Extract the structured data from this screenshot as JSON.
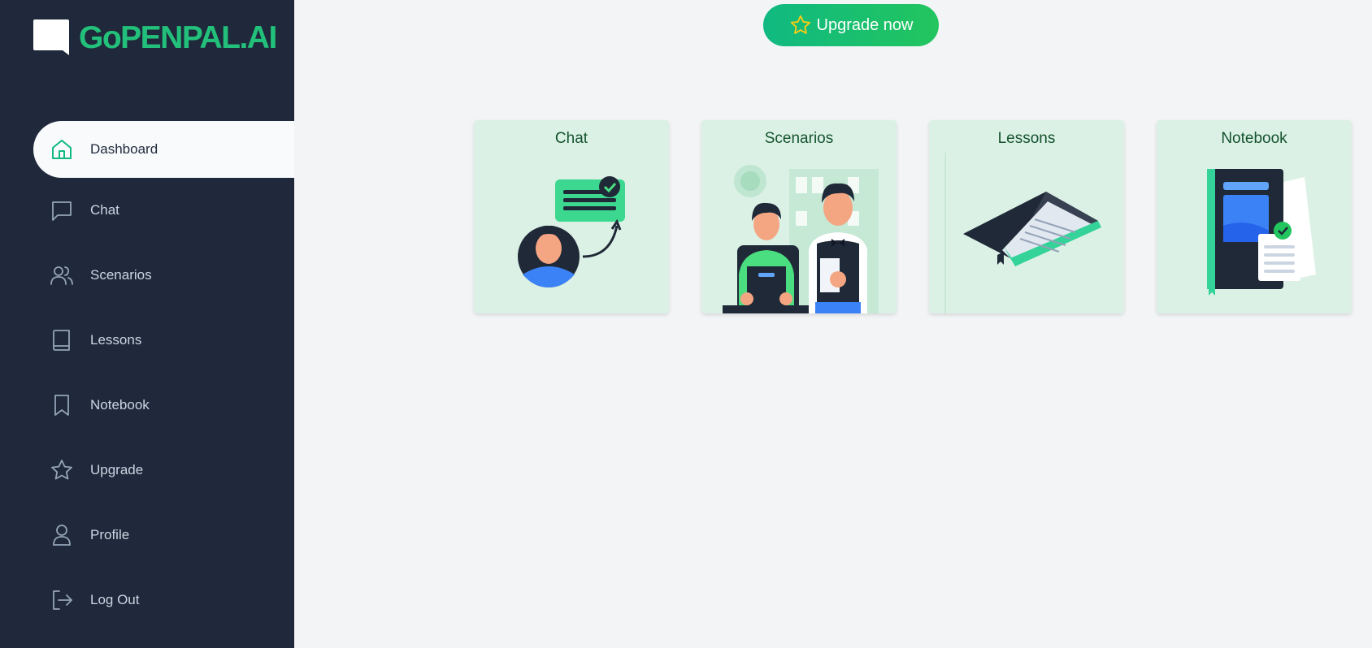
{
  "brand": {
    "name": "GoPENPAL.AI",
    "color": "#22c07a"
  },
  "sidebar": {
    "items": [
      {
        "label": "Dashboard",
        "icon": "home-icon",
        "active": true
      },
      {
        "label": "Chat",
        "icon": "chat-bubble-icon"
      },
      {
        "label": "Scenarios",
        "icon": "users-icon"
      },
      {
        "label": "Lessons",
        "icon": "book-icon"
      },
      {
        "label": "Notebook",
        "icon": "bookmark-icon"
      },
      {
        "label": "Upgrade",
        "icon": "star-icon"
      },
      {
        "label": "Profile",
        "icon": "user-icon"
      },
      {
        "label": "Log Out",
        "icon": "logout-icon"
      }
    ]
  },
  "header": {
    "upgrade_label": "Upgrade now",
    "upgrade_icon": "star-icon"
  },
  "cards": [
    {
      "title": "Chat",
      "illustration": "chat-illustration"
    },
    {
      "title": "Scenarios",
      "illustration": "scenarios-illustration"
    },
    {
      "title": "Lessons",
      "illustration": "open-book-illustration"
    },
    {
      "title": "Notebook",
      "illustration": "notebook-illustration"
    }
  ],
  "colors": {
    "sidebar_bg": "#1f293b",
    "accent": "#10b981",
    "card_bg": "#dcf1e6",
    "page_bg": "#f3f4f6"
  }
}
